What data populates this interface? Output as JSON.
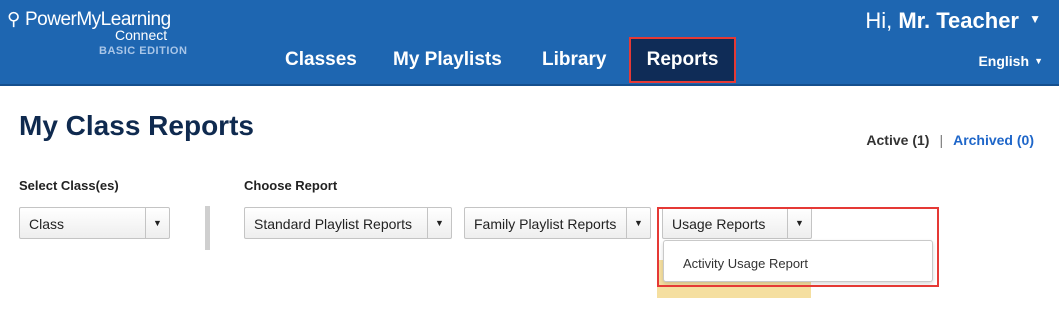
{
  "brand": {
    "name": "PowerMyLearning",
    "sub": "Connect",
    "edition": "BASIC EDITION"
  },
  "nav": {
    "classes": "Classes",
    "playlists": "My Playlists",
    "library": "Library",
    "reports": "Reports"
  },
  "user": {
    "greeting": "Hi,",
    "name": "Mr. Teacher",
    "language": "English"
  },
  "page": {
    "title": "My Class Reports"
  },
  "filter": {
    "active": "Active (1)",
    "separator": "|",
    "archived": "Archived (0)"
  },
  "select_class": {
    "label": "Select Class(es)",
    "value": "Class"
  },
  "choose_report": {
    "label": "Choose Report",
    "standard": "Standard Playlist Reports",
    "family": "Family Playlist Reports",
    "usage": "Usage Reports"
  },
  "usage_dropdown": {
    "items": [
      "Activity Usage Report"
    ]
  },
  "colors": {
    "header": "#1e66b1",
    "active_tab": "#0f2c57",
    "highlight": "#e53935",
    "title": "#0f2a4f",
    "link": "#1e66c9"
  },
  "icons": {
    "logo_figure": "person-arms-up-icon",
    "caret": "caret-down-icon",
    "select_arrow": "caret-down-icon"
  }
}
